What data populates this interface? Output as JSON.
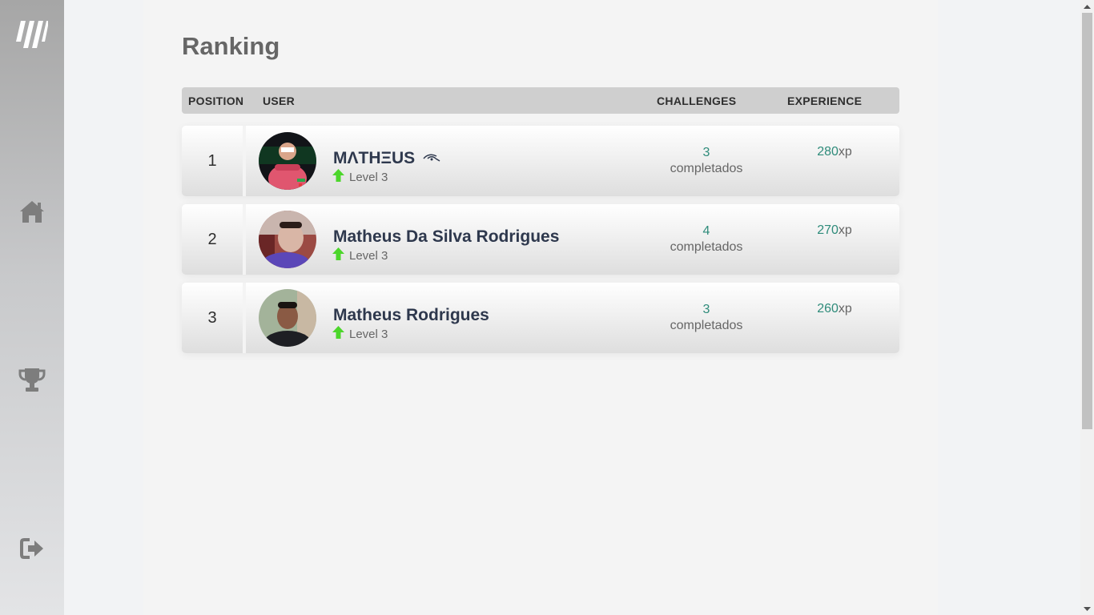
{
  "sidebar": {
    "logo": "moveit-logo",
    "items": [
      {
        "name": "home",
        "icon": "home-icon"
      },
      {
        "name": "leaderboard",
        "icon": "trophy-icon"
      },
      {
        "name": "logout",
        "icon": "logout-icon"
      }
    ]
  },
  "page": {
    "title": "Ranking"
  },
  "table": {
    "headers": {
      "position": "POSITION",
      "user": "USER",
      "challenges": "CHALLENGES",
      "experience": "EXPERIENCE"
    },
    "rows": [
      {
        "position": "1",
        "name": "MΛTHΞUS",
        "level": "Level 3",
        "challenges": "3",
        "challenges_label": "completados",
        "xp": "280",
        "xp_unit": "xp"
      },
      {
        "position": "2",
        "name": "Matheus Da Silva Rodrigues",
        "level": "Level 3",
        "challenges": "4",
        "challenges_label": "completados",
        "xp": "270",
        "xp_unit": "xp"
      },
      {
        "position": "3",
        "name": "Matheus Rodrigues",
        "level": "Level 3",
        "challenges": "3",
        "challenges_label": "completados",
        "xp": "260",
        "xp_unit": "xp"
      }
    ]
  },
  "colors": {
    "accent_green": "#2e8b7a",
    "level_arrow": "#4cd62b",
    "title": "#666666"
  }
}
